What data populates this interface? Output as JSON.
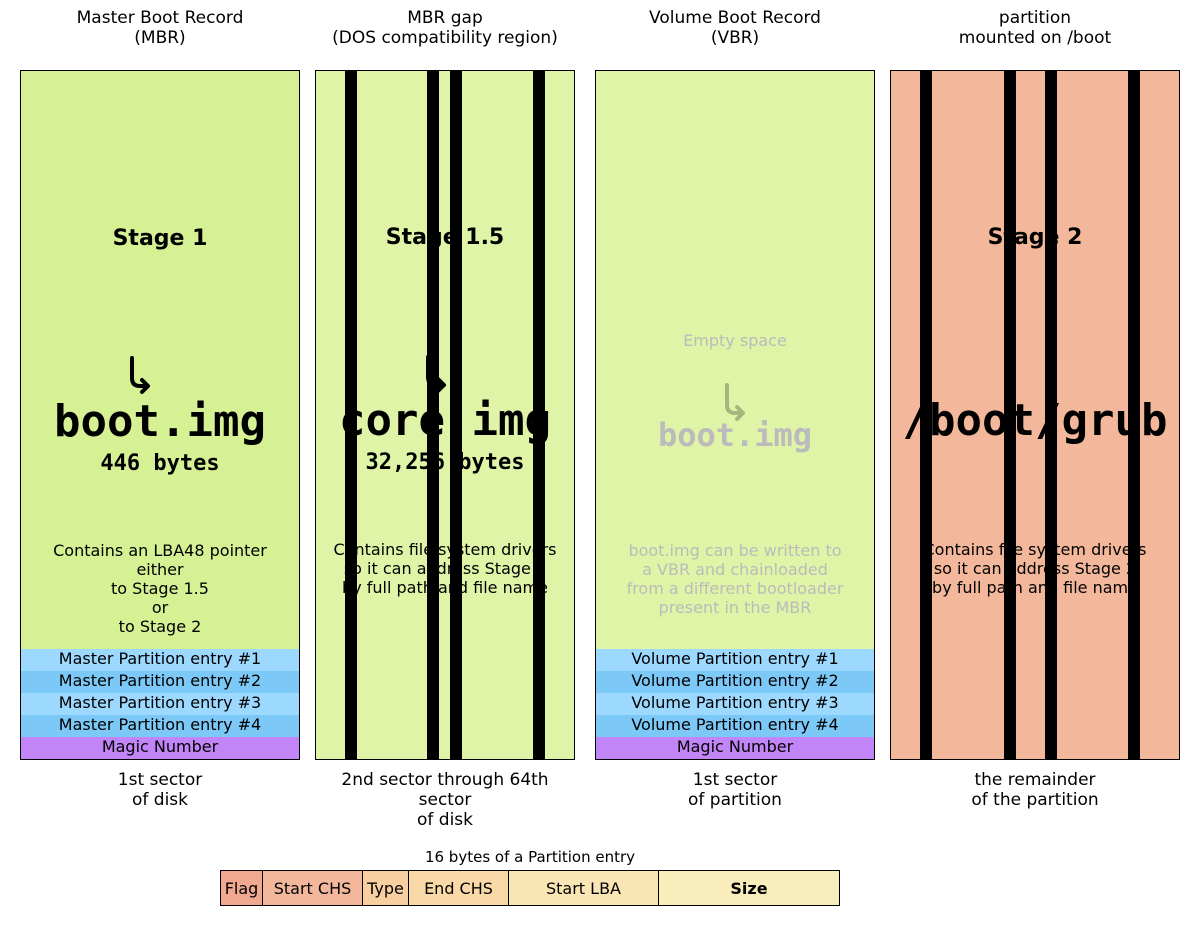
{
  "top": {
    "mbr": "Master Boot Record\n(MBR)",
    "gap": "MBR gap\n(DOS compatibility region)",
    "vbr": "Volume Boot Record\n(VBR)",
    "part": "partition\nmounted on /boot"
  },
  "stage1": {
    "title": "Stage 1",
    "file": "boot.img",
    "bytes": "446 bytes",
    "desc": "Contains an LBA48 pointer\neither\nto Stage 1.5\nor\nto Stage 2"
  },
  "stage15": {
    "title": "Stage 1.5",
    "file": "core.img",
    "bytes": "32,256 bytes",
    "desc": "Contains file system drivers\nso it can address Stage 2\nby full path and file name"
  },
  "vbr": {
    "empty": "Empty space",
    "file": "boot.img",
    "desc": "boot.img can be written to\na VBR and chainloaded\nfrom a different bootloader\npresent in the MBR"
  },
  "stage2": {
    "title": "Stage 2",
    "file": "/boot/grub",
    "desc": "Contains file system drivers\nso it can address Stage 2\nby full path and file name"
  },
  "partitions_master": [
    "Master Partition entry #1",
    "Master Partition entry #2",
    "Master Partition entry #3",
    "Master Partition entry #4"
  ],
  "partitions_volume": [
    "Volume Partition entry #1",
    "Volume Partition entry #2",
    "Volume Partition entry #3",
    "Volume Partition entry #4"
  ],
  "magic": "Magic Number",
  "bottom": {
    "sector1": "1st sector\nof disk",
    "sector2_64": "2nd sector through 64th sector\nof disk",
    "sector1p": "1st sector\nof partition",
    "sectorrest": "the remainder\nof the partition"
  },
  "legend": {
    "title": "16 bytes of a Partition entry",
    "flag": "Flag",
    "schs": "Start CHS",
    "type": "Type",
    "echs": "End CHS",
    "slba": "Start LBA",
    "size": "Size"
  }
}
